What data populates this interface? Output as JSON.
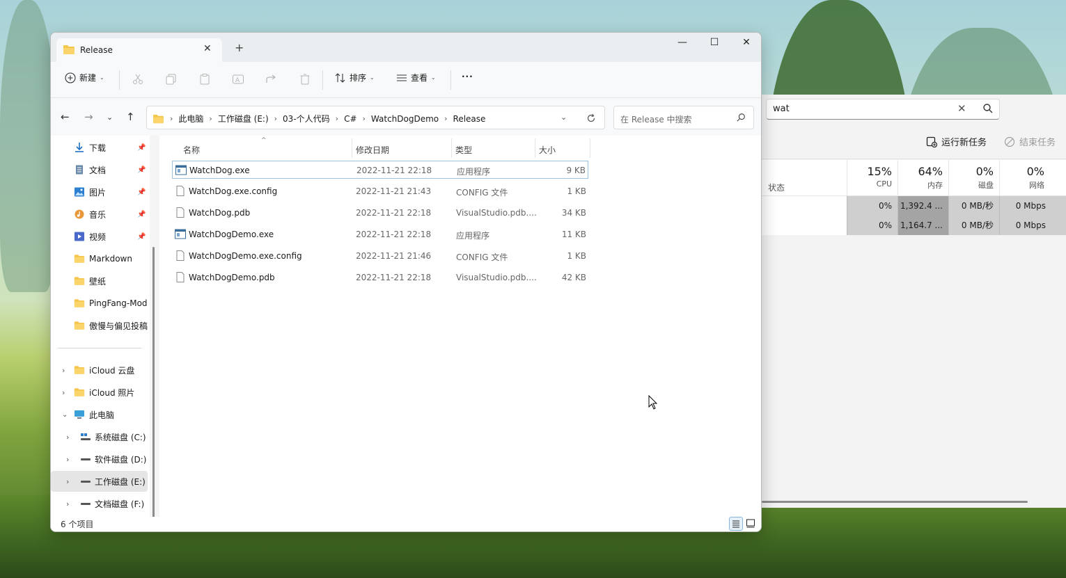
{
  "explorer": {
    "tab_title": "Release",
    "window_controls": {
      "minimize": "—",
      "maximize": "☐",
      "close": "✕"
    },
    "toolbar": {
      "new_label": "新建",
      "sort_label": "排序",
      "view_label": "查看",
      "more_label": "···"
    },
    "breadcrumbs": [
      "此电脑",
      "工作磁盘 (E:)",
      "03-个人代码",
      "C#",
      "WatchDogDemo",
      "Release"
    ],
    "search_placeholder": "在 Release 中搜索",
    "nav": {
      "quick": [
        {
          "label": "下载",
          "icon": "download-icon",
          "pinned": true
        },
        {
          "label": "文档",
          "icon": "document-icon",
          "pinned": true
        },
        {
          "label": "图片",
          "icon": "picture-icon",
          "pinned": true
        },
        {
          "label": "音乐",
          "icon": "music-icon",
          "pinned": true
        },
        {
          "label": "视频",
          "icon": "video-icon",
          "pinned": true
        },
        {
          "label": "Markdown",
          "icon": "folder-icon",
          "pinned": false
        },
        {
          "label": "壁纸",
          "icon": "folder-icon",
          "pinned": false
        },
        {
          "label": "PingFang-Mod",
          "icon": "folder-icon",
          "pinned": false
        },
        {
          "label": "傲慢与偏见投稿",
          "icon": "folder-icon",
          "pinned": false
        }
      ],
      "tree": [
        {
          "label": "iCloud 云盘",
          "icon": "folder-icon"
        },
        {
          "label": "iCloud 照片",
          "icon": "folder-icon"
        },
        {
          "label": "此电脑",
          "icon": "computer-icon"
        },
        {
          "label": "系统磁盘 (C:)",
          "icon": "drive-icon"
        },
        {
          "label": "软件磁盘 (D:)",
          "icon": "drive-icon"
        },
        {
          "label": "工作磁盘 (E:)",
          "icon": "drive-icon"
        },
        {
          "label": "文档磁盘 (F:)",
          "icon": "drive-icon"
        }
      ]
    },
    "columns": {
      "name": "名称",
      "date": "修改日期",
      "type": "类型",
      "size": "大小"
    },
    "files": [
      {
        "name": "WatchDog.exe",
        "date": "2022-11-21 22:18",
        "type": "应用程序",
        "size": "9 KB",
        "icon": "exe-icon"
      },
      {
        "name": "WatchDog.exe.config",
        "date": "2022-11-21 21:43",
        "type": "CONFIG 文件",
        "size": "1 KB",
        "icon": "file-icon"
      },
      {
        "name": "WatchDog.pdb",
        "date": "2022-11-21 22:18",
        "type": "VisualStudio.pdb....",
        "size": "34 KB",
        "icon": "file-icon"
      },
      {
        "name": "WatchDogDemo.exe",
        "date": "2022-11-21 22:18",
        "type": "应用程序",
        "size": "11 KB",
        "icon": "exe-icon"
      },
      {
        "name": "WatchDogDemo.exe.config",
        "date": "2022-11-21 21:46",
        "type": "CONFIG 文件",
        "size": "1 KB",
        "icon": "file-icon"
      },
      {
        "name": "WatchDogDemo.pdb",
        "date": "2022-11-21 22:18",
        "type": "VisualStudio.pdb....",
        "size": "42 KB",
        "icon": "file-icon"
      }
    ],
    "status": "6 个项目"
  },
  "taskmgr": {
    "search_value": "wat",
    "run_task_label": "运行新任务",
    "end_task_label": "结束任务",
    "status_col": "状态",
    "columns": [
      {
        "pct": "15%",
        "label": "CPU"
      },
      {
        "pct": "64%",
        "label": "内存"
      },
      {
        "pct": "0%",
        "label": "磁盘"
      },
      {
        "pct": "0%",
        "label": "网络"
      }
    ],
    "rows": [
      [
        "0%",
        "1,392.4 ...",
        "0 MB/秒",
        "0 Mbps"
      ],
      [
        "0%",
        "1,164.7 ...",
        "0 MB/秒",
        "0 Mbps"
      ]
    ]
  }
}
